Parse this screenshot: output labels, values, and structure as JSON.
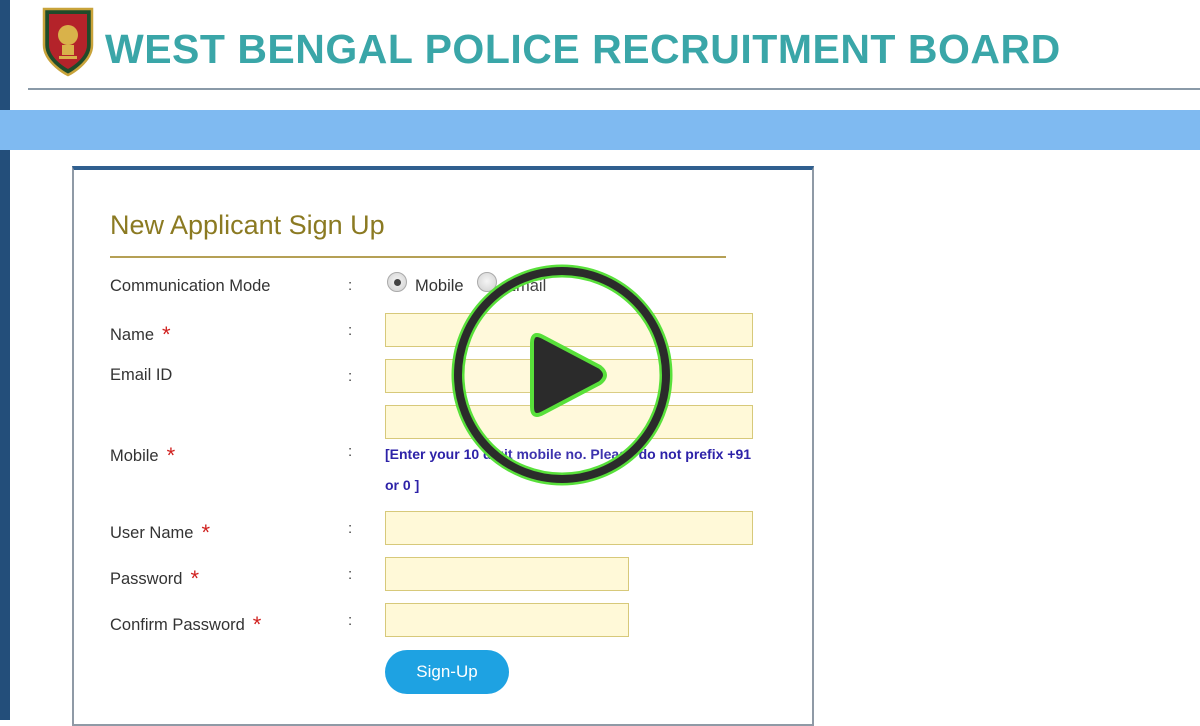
{
  "header": {
    "title": "WEST BENGAL POLICE RECRUITMENT BOARD"
  },
  "form": {
    "title": "New Applicant Sign Up",
    "communication_mode": {
      "label": "Communication Mode",
      "options": [
        "Mobile",
        "Email"
      ],
      "selected": "Mobile"
    },
    "name_label": "Name",
    "email_label": "Email ID",
    "mobile_label": "Mobile",
    "mobile_hint_line1": "[Enter your 10 digit mobile no. Please do not prefix +91",
    "mobile_hint_line2": "or 0 ]",
    "username_label": "User Name",
    "password_label": "Password",
    "confirm_password_label": "Confirm Password",
    "required_mark": "*",
    "colon": ":",
    "submit_label": "Sign-Up"
  },
  "colors": {
    "title": "#3aa6a8",
    "nav_band": "#7fbaf1",
    "form_title": "#8b7a22",
    "field_bg": "#fff9d8",
    "required": "#d0201e",
    "hint": "#2d22a8",
    "button": "#1ea2e2",
    "play_ring": "#58e03a"
  },
  "icons": {
    "logo": "west-bengal-police-emblem",
    "overlay": "play-icon"
  }
}
